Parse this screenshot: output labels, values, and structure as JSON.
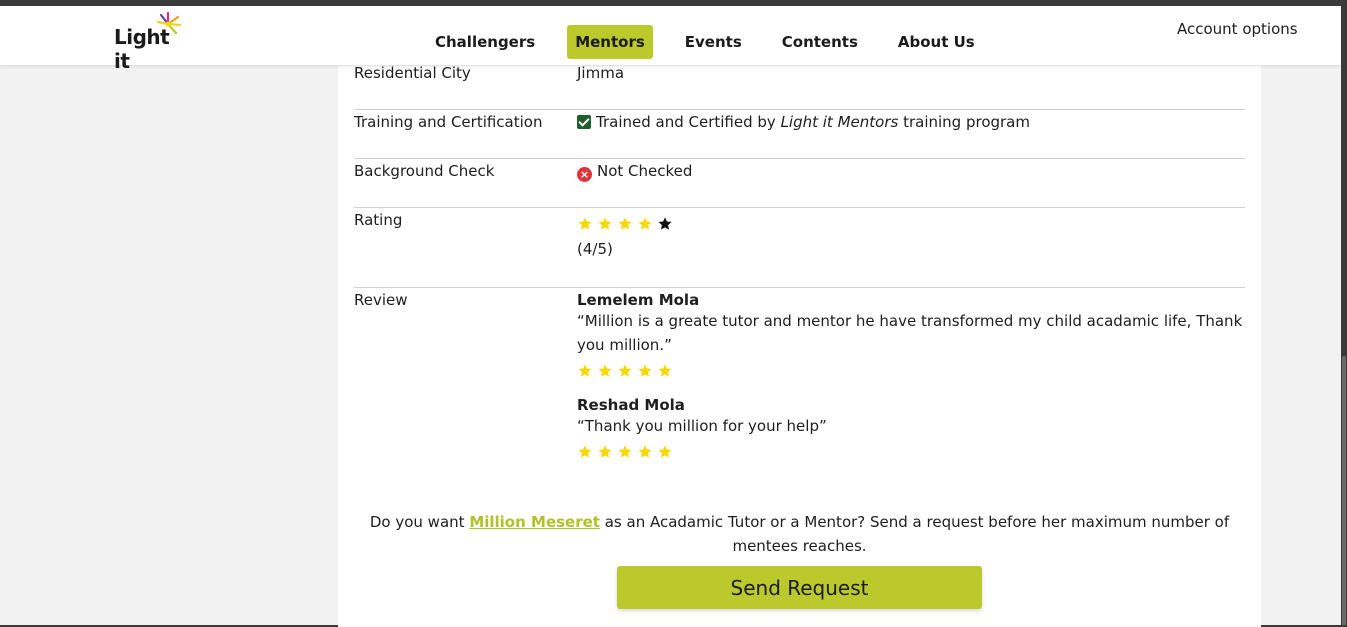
{
  "logo": {
    "text": "Light it"
  },
  "nav": {
    "items": [
      {
        "label": "Challengers"
      },
      {
        "label": "Mentors"
      },
      {
        "label": "Events"
      },
      {
        "label": "Contents"
      },
      {
        "label": "About Us"
      }
    ],
    "active": "Mentors",
    "account_label": "Account options"
  },
  "profile": {
    "residential_city": {
      "label": "Residential City",
      "value": "Jimma"
    },
    "training": {
      "label": "Training and Certification",
      "value_prefix": "Trained and Certified by ",
      "value_emphasis": "Light it Mentors",
      "value_suffix": " training program"
    },
    "background": {
      "label": "Background Check",
      "value": "Not Checked"
    },
    "rating": {
      "label": "Rating",
      "value": 4,
      "max": 5,
      "text": "(4/5)"
    },
    "review_label": "Review",
    "reviews": [
      {
        "name": "Lemelem Mola",
        "text": "“Million is a greate tutor and mentor he have transformed my child acadamic life, Thank you million.”",
        "stars": 5
      },
      {
        "name": "Reshad Mola",
        "text": "“Thank you million for your help”",
        "stars": 5
      }
    ]
  },
  "cta": {
    "prefix": "Do you want ",
    "mentor_name": "Million Meseret",
    "suffix": " as an Acadamic Tutor or a Mentor? Send a request before her maximum number of mentees reaches.",
    "button_label": "Send Request"
  },
  "colors": {
    "accent": "#bbc92c",
    "star_filled": "#f5d90a",
    "star_empty": "#111111",
    "check_green": "#1f5e2c",
    "error_red": "#e0333a"
  }
}
